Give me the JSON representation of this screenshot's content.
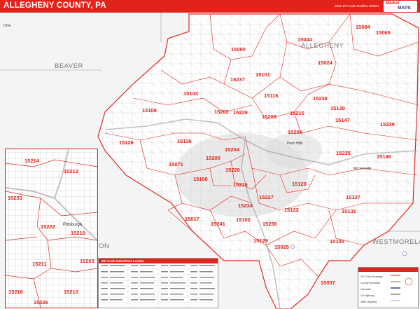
{
  "header": {
    "title": "ALLEGHENY COUNTY, PA",
    "subtitle": "2021 ZIP Code Redline Edition",
    "logo_top": "Market",
    "logo_bottom": "MAPS"
  },
  "map": {
    "accent_color": "#e2231a",
    "counties": [
      "BEAVER",
      "ALLEGHENY",
      "WESTMORELAND"
    ],
    "partial_labels": [
      "Ohio",
      "TON"
    ],
    "zip_labels": [
      "15084",
      "15044",
      "15065",
      "15090",
      "15024",
      "15101",
      "15237",
      "15116",
      "15238",
      "15143",
      "15108",
      "15202",
      "15229",
      "15209",
      "15215",
      "15139",
      "15147",
      "15239",
      "15126",
      "15136",
      "15205",
      "15204",
      "15206",
      "15235",
      "15071",
      "15146",
      "15106",
      "15220",
      "15216",
      "15120",
      "15137",
      "15122",
      "15227",
      "15234",
      "15241",
      "15102",
      "15017",
      "15236",
      "15131",
      "15129",
      "15025",
      "15135",
      "15037",
      "15212",
      "15214",
      "15210",
      "15203",
      "15222"
    ],
    "place_labels": [
      "Penn Hills",
      "Monroeville"
    ]
  },
  "inset": {
    "zip_labels": [
      "15214",
      "15212",
      "15233",
      "15222",
      "15219",
      "15211",
      "15203",
      "15216",
      "15210",
      "15226"
    ],
    "city": "Pittsburgh"
  },
  "index_table": {
    "title": "ZIP Code Index/Post Locator"
  },
  "legend": {
    "items": [
      "ZIP Code Boundary",
      "County Boundary",
      "Interstate",
      "US Highway",
      "State Highway"
    ]
  }
}
